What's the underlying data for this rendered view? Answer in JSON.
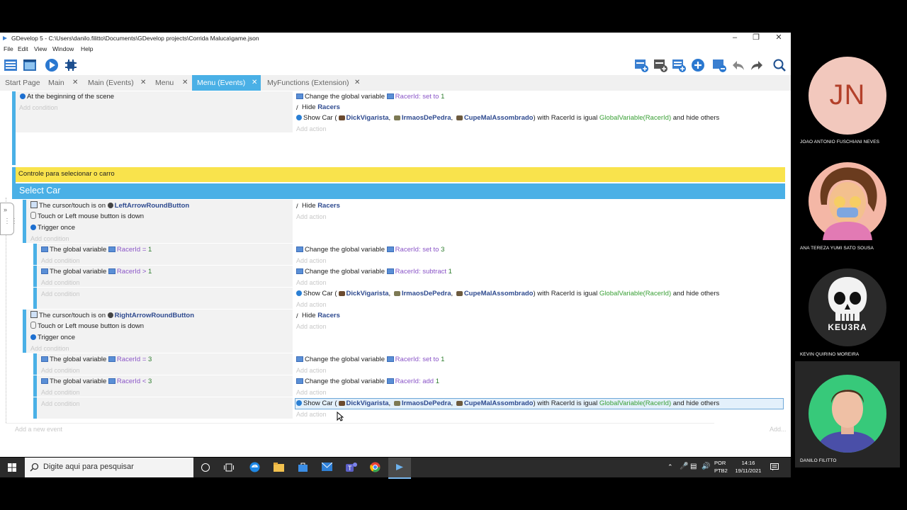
{
  "window": {
    "title": "GDevelop 5 - C:\\Users\\danilo.filitto\\Documents\\GDevelop projects\\Corrida Maluca\\game.json"
  },
  "menu": [
    "File",
    "Edit",
    "View",
    "Window",
    "Help"
  ],
  "tabs": [
    {
      "label": "Start Page",
      "close": false
    },
    {
      "label": "Main",
      "close": true
    },
    {
      "label": "Main (Events)",
      "close": true
    },
    {
      "label": "Menu",
      "close": true
    },
    {
      "label": "Menu (Events)",
      "close": true,
      "active": true
    },
    {
      "label": "MyFunctions (Extension)",
      "close": true
    }
  ],
  "common": {
    "add_condition": "Add condition",
    "add_action": "Add action",
    "add_event": "Add a new event",
    "add": "Add...",
    "change_global": "Change the global variable",
    "global_variable": "The global variable",
    "var_name": "RacerId",
    "set_to": "set to",
    "subtract": "subtract",
    "add_op": "add",
    "hide": "Hide",
    "racers": "Racers",
    "show_car": "Show Car (",
    "obj1": "DickVigarista",
    "obj2": "IrmaosDePedra",
    "obj3": "CupeMalAssombrado",
    "with_racer": ") with RacerId is igual",
    "global_var_expr": "GlobalVariable(RacerId)",
    "hide_others": "and hide others",
    "cursor_on": "The cursor/touch is on",
    "touch_or": "Touch or",
    "left_word": "Left",
    "mouse_down": "mouse button is down",
    "trigger_once": "Trigger once",
    "colon": ":",
    "comma": ","
  },
  "events": {
    "scene_start": "At the beginning of the scene",
    "val_1": "1",
    "val_3": "3",
    "comment": "Controle para selecionar o carro",
    "group": "Select Car",
    "left_button": "LeftArrowRoundButton",
    "right_button": "RightArrowRoundButton",
    "eq": "=",
    "gt": ">",
    "lt": "<"
  },
  "taskbar": {
    "search_placeholder": "Digite aqui para pesquisar",
    "lang": "POR",
    "layout": "PTB2",
    "time": "14:16",
    "date": "19/11/2021"
  },
  "participants": [
    {
      "name": "JOAO ANTONIO FUSCHIANI NEVES",
      "initials": "JN",
      "avatar_color": "#f2c8bd",
      "initials_color": "#b3402a"
    },
    {
      "name": "ANA TEREZA YUMI SATO SOUSA"
    },
    {
      "name": "KEVIN QUIRINO MOREIRA",
      "badge": "KEU3RA"
    },
    {
      "name": "DANILO FILITTO"
    }
  ],
  "colors": {
    "accent": "#4ab0e6",
    "comment": "#f9e34c",
    "variable": "#8a55c7",
    "object": "#2e4a8f",
    "number": "#2c7c2c",
    "expression": "#3aa036"
  }
}
